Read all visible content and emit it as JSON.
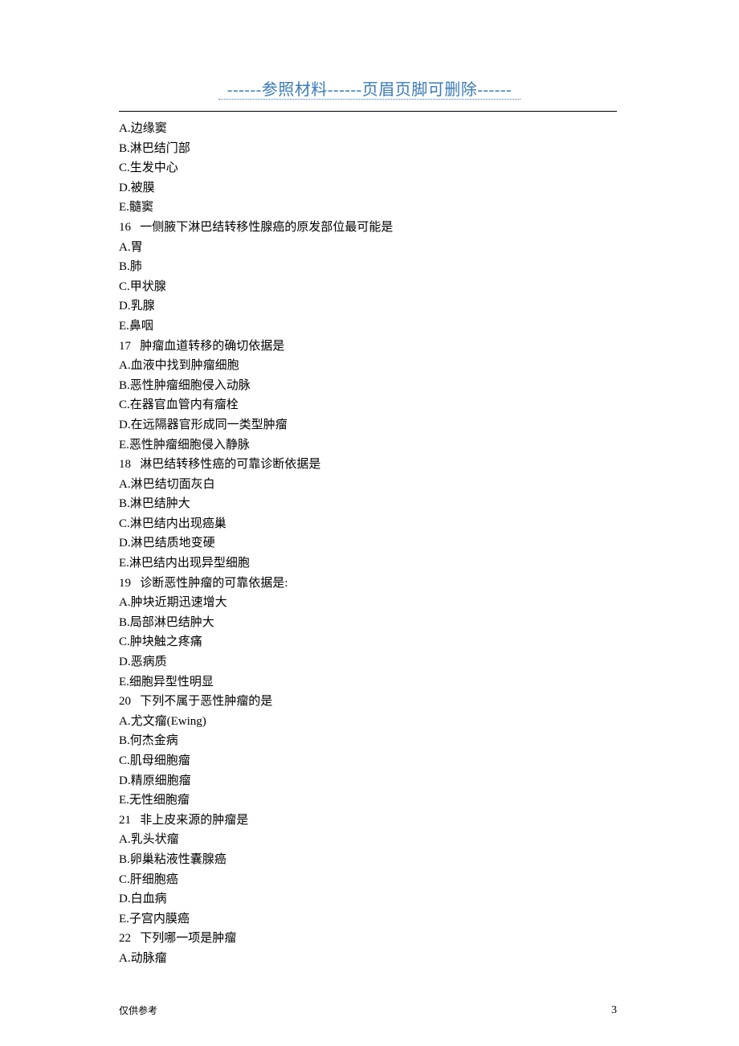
{
  "header": "------参照材料------页眉页脚可删除------",
  "lines": [
    "A.边缘窦",
    "B.淋巴结门部",
    "C.生发中心",
    "D.被膜",
    "E.髓窦",
    "16   一侧腋下淋巴结转移性腺癌的原发部位最可能是",
    "A.胃",
    "B.肺",
    "C.甲状腺",
    "D.乳腺",
    "E.鼻咽",
    "17   肿瘤血道转移的确切依据是",
    "A.血液中找到肿瘤细胞",
    "B.恶性肿瘤细胞侵入动脉",
    "C.在器官血管内有瘤栓",
    "D.在远隔器官形成同一类型肿瘤",
    "E.恶性肿瘤细胞侵入静脉",
    "18   淋巴结转移性癌的可靠诊断依据是",
    "A.淋巴结切面灰白",
    "B.淋巴结肿大",
    "C.淋巴结内出现癌巢",
    "D.淋巴结质地变硬",
    "E.淋巴结内出现异型细胞",
    "19   诊断恶性肿瘤的可靠依据是:",
    "A.肿块近期迅速增大",
    "B.局部淋巴结肿大",
    "C.肿块触之疼痛",
    "D.恶病质",
    "E.细胞异型性明显",
    "20   下列不属于恶性肿瘤的是",
    "A.尤文瘤(Ewing)",
    "B.何杰金病",
    "C.肌母细胞瘤",
    "D.精原细胞瘤",
    "E.无性细胞瘤",
    "21   非上皮来源的肿瘤是",
    "A.乳头状瘤",
    "B.卵巢粘液性囊腺癌",
    "C.肝细胞癌",
    "D.白血病",
    "E.子宫内膜癌",
    "22   下列哪一项是肿瘤",
    "A.动脉瘤"
  ],
  "footer_left": "仅供参考",
  "footer_right": "3"
}
